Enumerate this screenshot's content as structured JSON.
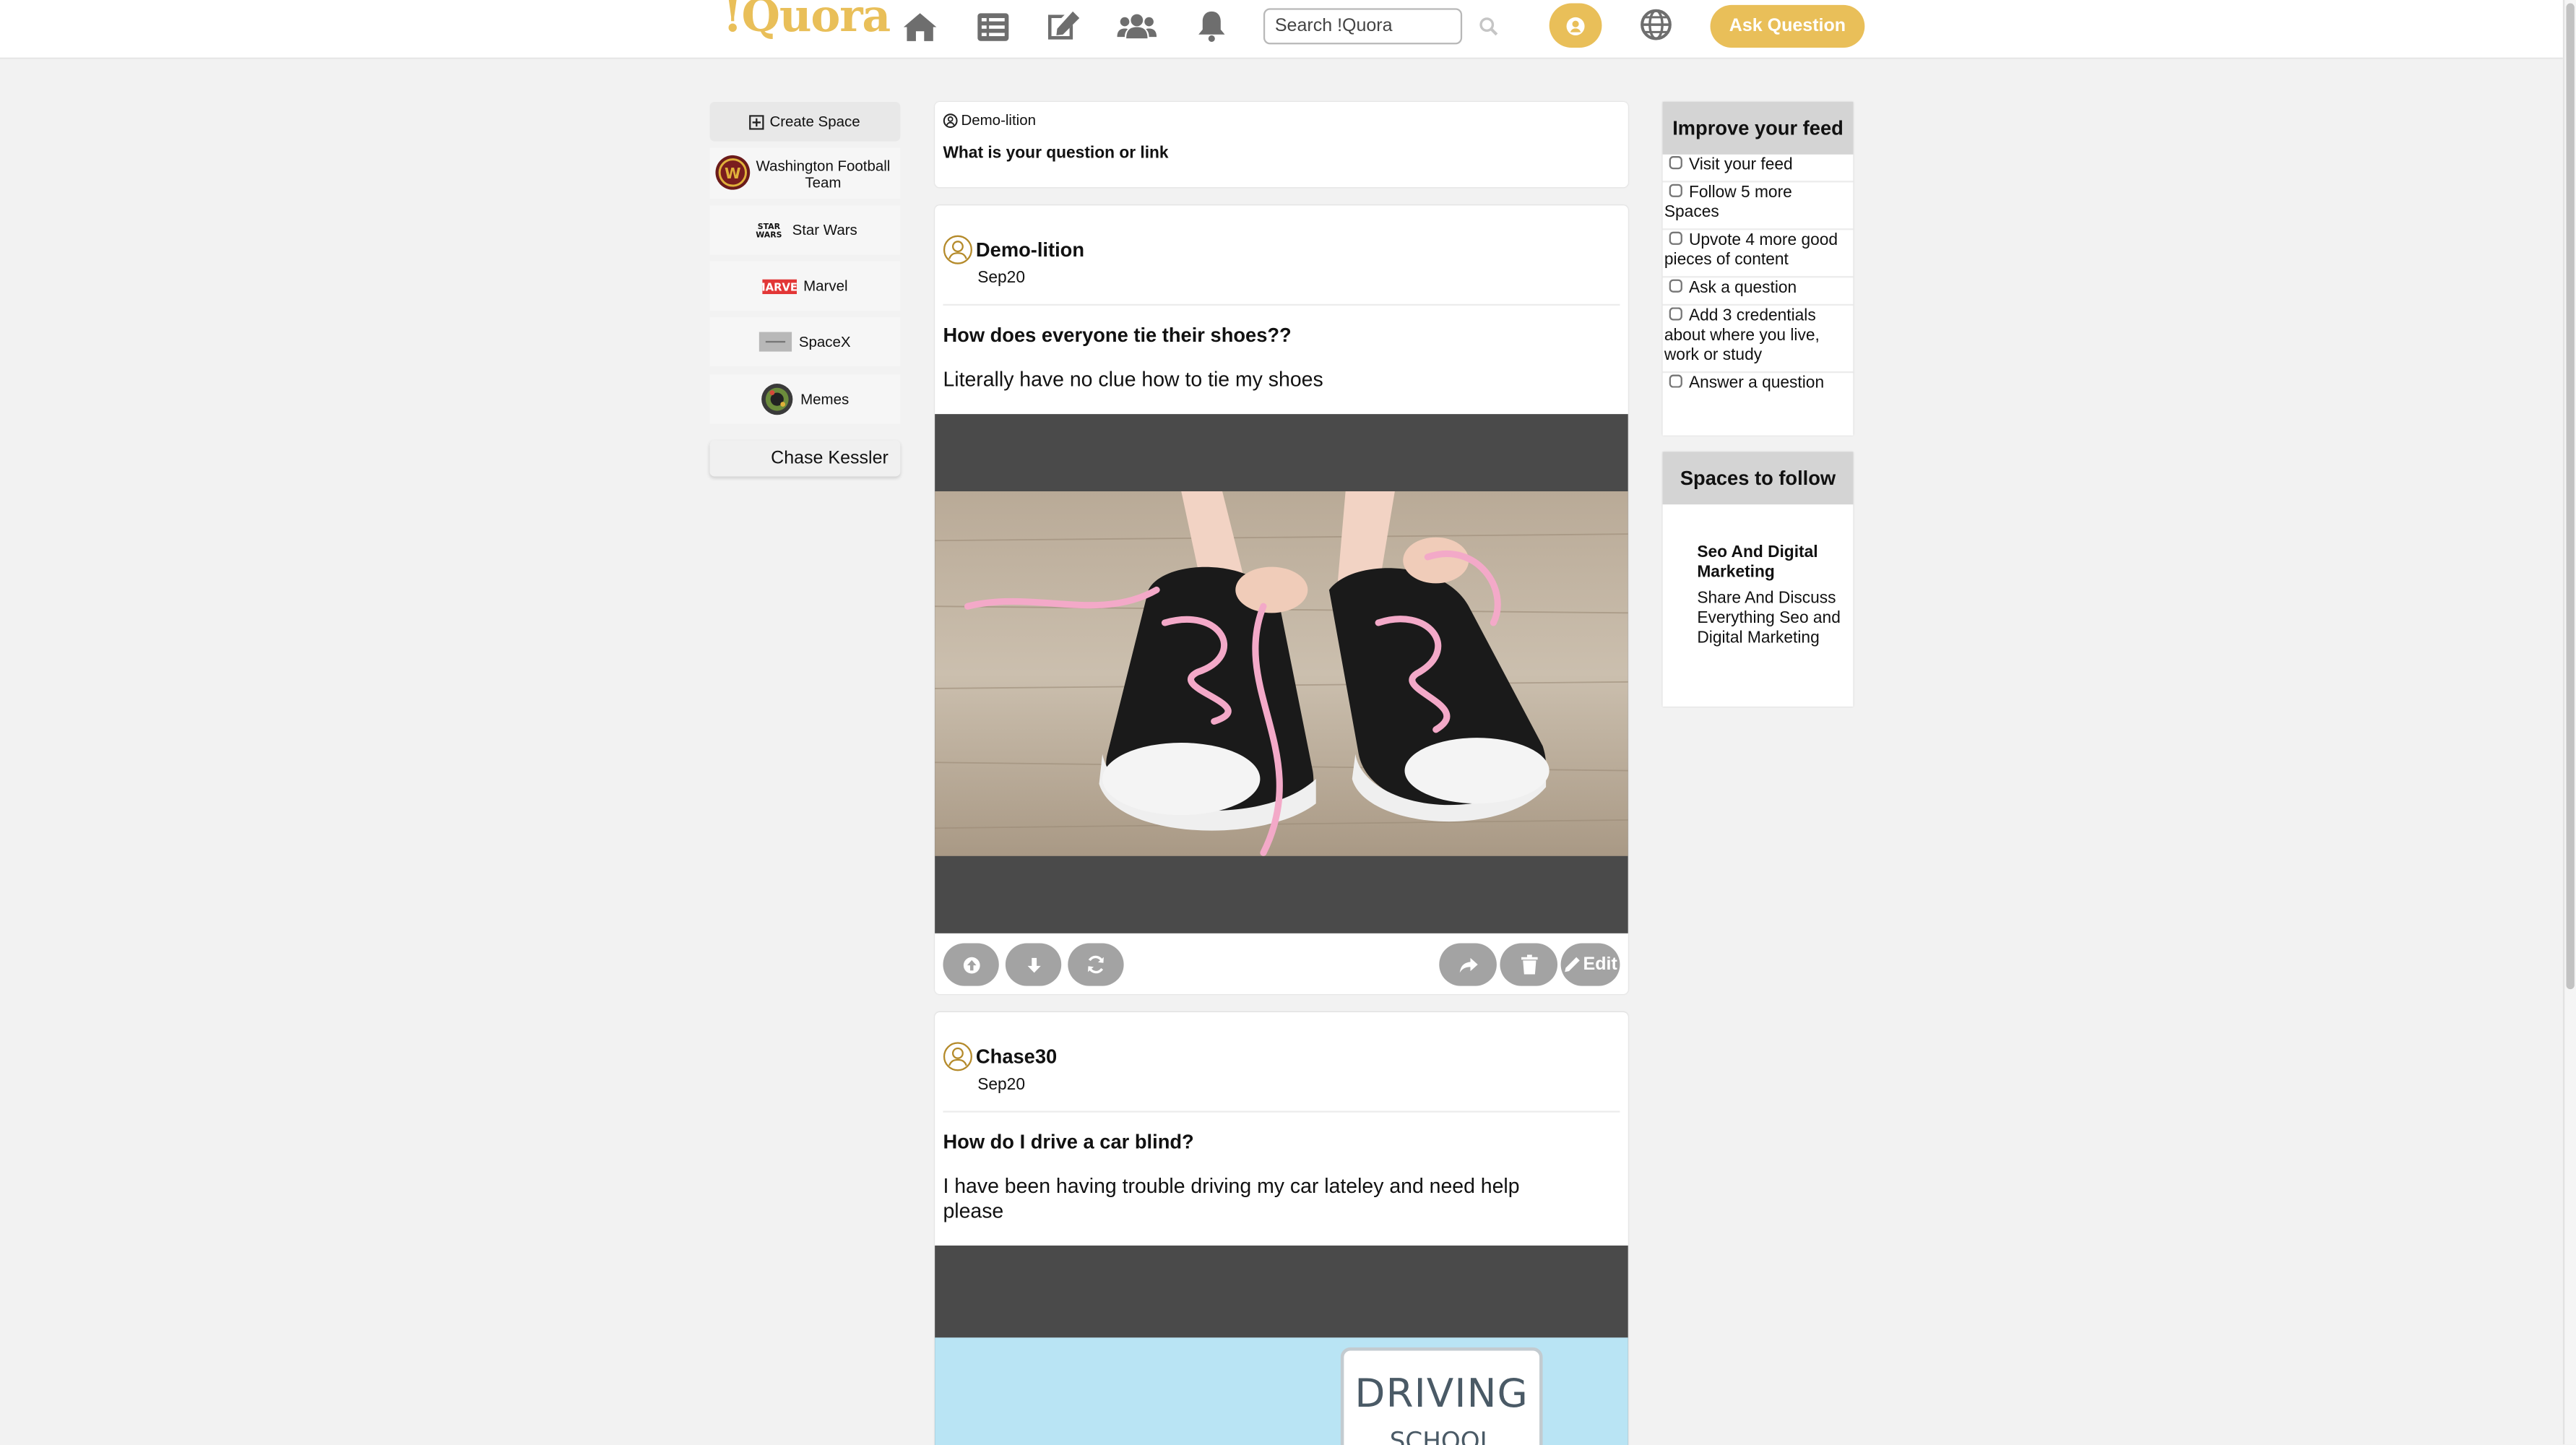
{
  "app": {
    "logo": "!Quora",
    "search_placeholder": "Search !Quora",
    "ask_button": "Ask Question",
    "accent_color": "#e9bf59"
  },
  "nav_icons": [
    "home-icon",
    "list-icon",
    "edit-icon",
    "users-icon",
    "bell-icon"
  ],
  "sidebar": {
    "create_label": "Create Space",
    "spaces": [
      {
        "label": "Washington Football Team",
        "icon": "washington-logo-icon"
      },
      {
        "label": "Star Wars",
        "icon": "star-wars-logo-icon"
      },
      {
        "label": "Marvel",
        "icon": "marvel-logo-icon"
      },
      {
        "label": "SpaceX",
        "icon": "spacex-logo-icon"
      },
      {
        "label": "Memes",
        "icon": "memes-logo-icon"
      }
    ],
    "user_name": "Chase Kessler"
  },
  "ask_box": {
    "user": "Demo-lition",
    "prompt": "What is your question or link"
  },
  "posts": [
    {
      "author": "Demo-lition",
      "date": "Sep20",
      "question": "How does everyone tie their shoes??",
      "body": "Literally have no clue how to tie my shoes",
      "media": "sneakers-photo",
      "edit_label": "Edit"
    },
    {
      "author": "Chase30",
      "date": "Sep20",
      "question": "How do I drive a car blind?",
      "body": "I have been having trouble driving my car lateley and need help please",
      "media": "driving-school-image",
      "sign_text_1": "DRIVING",
      "sign_text_2": "SCHOOL"
    }
  ],
  "improve_feed": {
    "title": "Improve your feed",
    "items": [
      "Visit your feed",
      "Follow 5 more Spaces",
      "Upvote 4 more good pieces of content",
      "Ask a question",
      "Add 3 credentials about where you live, work or study",
      "Answer a question"
    ]
  },
  "spaces_to_follow": {
    "title": "Spaces to follow",
    "name": "Seo And Digital Marketing",
    "description": "Share And Discuss Everything Seo and Digital Marketing"
  }
}
